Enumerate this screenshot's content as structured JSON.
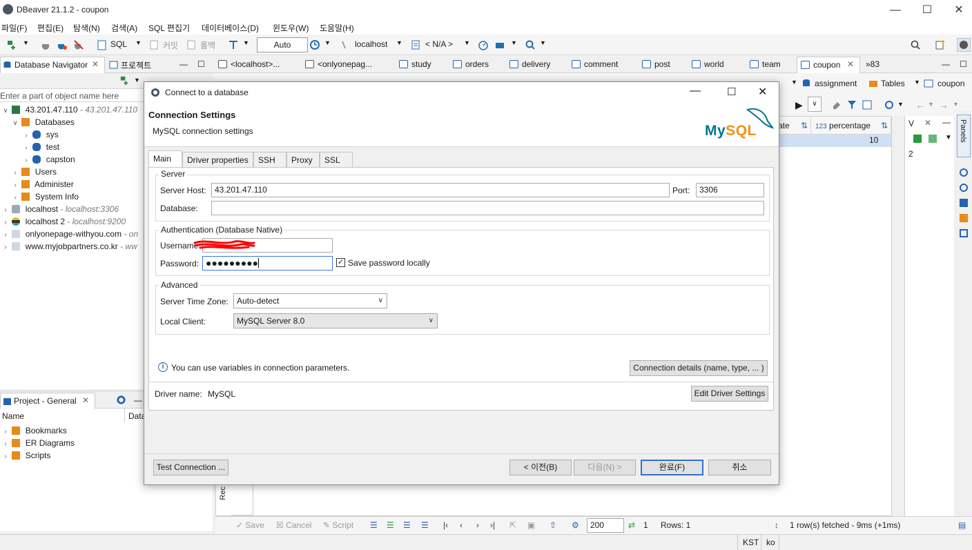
{
  "window": {
    "title": "DBeaver 21.1.2 - coupon"
  },
  "menu": [
    "파일(F)",
    "편집(E)",
    "탐색(N)",
    "검색(A)",
    "SQL 편집기",
    "데이터베이스(D)",
    "윈도우(W)",
    "도움말(H)"
  ],
  "toolbar": {
    "sql": "SQL",
    "commit": "커밋",
    "rollback": "롤백",
    "auto": "Auto",
    "datasource": "localhost",
    "schema": "< N/A >"
  },
  "navigator": {
    "tab_label": "Database Navigator",
    "project_tab_label": "프로젝트",
    "filter_placeholder": "Enter a part of object name here",
    "tree": [
      {
        "label": "43.201.47.110",
        "sub": "- 43.201.47.110"
      },
      {
        "label": "Databases"
      },
      {
        "label": "sys"
      },
      {
        "label": "test"
      },
      {
        "label": "capston"
      },
      {
        "label": "Users"
      },
      {
        "label": "Administer"
      },
      {
        "label": "System Info"
      },
      {
        "label": "localhost",
        "sub": "- localhost:3306"
      },
      {
        "label": "localhost 2",
        "sub": "- localhost:9200"
      },
      {
        "label": "onlyonepage-withyou.com",
        "sub": "- on"
      },
      {
        "label": "www.myjobpartners.co.kr",
        "sub": "- ww"
      }
    ]
  },
  "project": {
    "tab_label": "Project - General",
    "col_name": "Name",
    "col_data": "Data",
    "items": [
      "Bookmarks",
      "ER Diagrams",
      "Scripts"
    ]
  },
  "editor_tabs": [
    "<localhost>...",
    "<onlyonepag...",
    "study",
    "orders",
    "delivery",
    "comment",
    "post",
    "world",
    "team",
    "coupon"
  ],
  "editor_tabs_more": "»83",
  "editor_toolbar": {
    "assignment": "assignment",
    "tables": "Tables",
    "coupon": "coupon"
  },
  "grid": {
    "col_date": "ate",
    "col_percentage": "percentage",
    "col_percentage_type": "123",
    "row_value": "10",
    "vpanel_title": "V",
    "vpanel_value": "2",
    "panels_label": "Panels"
  },
  "bottom_bar": {
    "save": "Save",
    "cancel": "Cancel",
    "script": "Script",
    "limit": "200",
    "refresh_count": "1",
    "rows": "Rows: 1",
    "fetched": "1 row(s) fetched - 9ms (+1ms)",
    "side_label": "Rec"
  },
  "status_bar": {
    "tz": "KST",
    "locale": "ko"
  },
  "dialog": {
    "title": "Connect to a database",
    "header_title": "Connection Settings",
    "header_subtitle": "MySQL connection settings",
    "logo_text": "MySQL",
    "tabs": [
      "Main",
      "Driver properties",
      "SSH",
      "Proxy",
      "SSL"
    ],
    "server_group": "Server",
    "server_host_label": "Server Host:",
    "server_host_value": "43.201.47.110",
    "port_label": "Port:",
    "port_value": "3306",
    "database_label": "Database:",
    "database_value": "",
    "auth_group": "Authentication (Database Native)",
    "username_label": "Username:",
    "password_label": "Password:",
    "password_mask": "●●●●●●●●●",
    "save_password_label": "Save password locally",
    "save_password_checked": true,
    "advanced_group": "Advanced",
    "timezone_label": "Server Time Zone:",
    "timezone_value": "Auto-detect",
    "local_client_label": "Local Client:",
    "local_client_value": "MySQL Server 8.0",
    "info_text": "You can use variables in connection parameters.",
    "connection_details_button": "Connection details (name, type, ... )",
    "driver_name_label": "Driver name:",
    "driver_name_value": "MySQL",
    "edit_driver_button": "Edit Driver Settings",
    "test_button": "Test Connection ...",
    "prev_button": "< 이전(B)",
    "next_button": "다음(N) >",
    "finish_button": "완료(F)",
    "cancel_button": "취소"
  },
  "colors": {
    "accent": "#2f6fd1",
    "mysql_blue": "#00758f",
    "mysql_orange": "#f29111",
    "selection": "#cfe0f5",
    "redaction": "#ff0000"
  }
}
